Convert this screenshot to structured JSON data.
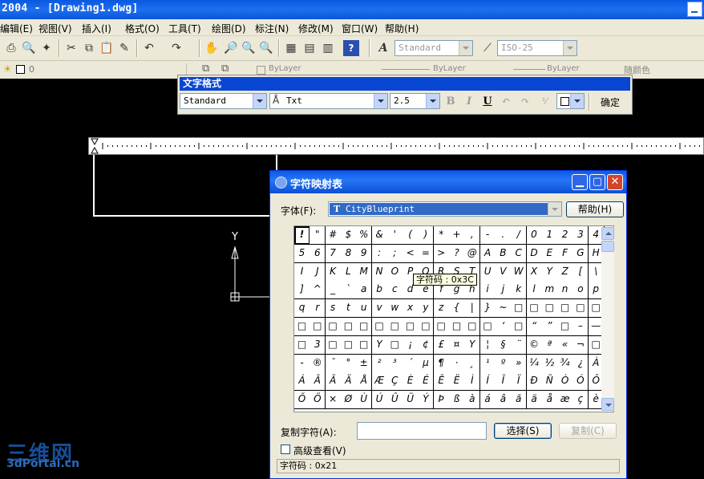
{
  "window": {
    "title": "2004 - [Drawing1.dwg]"
  },
  "menu": [
    "编辑(E)",
    "视图(V)",
    "插入(I)",
    "格式(O)",
    "工具(T)",
    "绘图(D)",
    "标注(N)",
    "修改(M)",
    "窗口(W)",
    "帮助(H)"
  ],
  "toolbar": {
    "text_style": "Standard",
    "dim_style": "ISO-25"
  },
  "layers": {
    "current": "0",
    "color": "ByLayer",
    "linetype": "ByLayer",
    "lineweight": "ByLayer",
    "plotstyle": "随颜色"
  },
  "text_formatting": {
    "title": "文字格式",
    "style": "Standard",
    "font": "Txt",
    "height": "2.5",
    "bold": "B",
    "italic": "I",
    "underline": "U",
    "ok": "确定"
  },
  "axes": {
    "y_label": "Y"
  },
  "charmap": {
    "title": "字符映射表",
    "font_label": "字体(F):",
    "font_value": "CityBlueprint",
    "help_button": "帮助(H)",
    "tooltip": "字符码 : 0x3C",
    "copy_label": "复制字符(A):",
    "copy_value": "",
    "select_button": "选择(S)",
    "copy_button": "复制(C)",
    "advanced_label": "高级查看(V)",
    "status": "字符码 : 0x21",
    "rows": [
      [
        "!",
        "\"",
        "#",
        "$",
        "%",
        "&",
        "'",
        "(",
        ")",
        "*",
        "+",
        ",",
        "-",
        ".",
        "/",
        "0",
        "1",
        "2",
        "3",
        "4"
      ],
      [
        "5",
        "6",
        "7",
        "8",
        "9",
        ":",
        ";",
        "<",
        "=",
        ">",
        "?",
        "@",
        "A",
        "B",
        "C",
        "D",
        "E",
        "F",
        "G",
        "H"
      ],
      [
        "I",
        "J",
        "K",
        "L",
        "M",
        "N",
        "O",
        "P",
        "Q",
        "R",
        "S",
        "T",
        "U",
        "V",
        "W",
        "X",
        "Y",
        "Z",
        "[",
        "\\"
      ],
      [
        "]",
        "^",
        "_",
        "`",
        "a",
        "b",
        "c",
        "d",
        "e",
        "f",
        "g",
        "h",
        "i",
        "j",
        "k",
        "l",
        "m",
        "n",
        "o",
        "p"
      ],
      [
        "q",
        "r",
        "s",
        "t",
        "u",
        "v",
        "w",
        "x",
        "y",
        "z",
        "{",
        "|",
        "}",
        "~",
        "□",
        "□",
        "□",
        "□",
        "□",
        "□"
      ],
      [
        "□",
        "□",
        "□",
        "□",
        "□",
        "□",
        "□",
        "□",
        "□",
        "□",
        "□",
        "□",
        "□",
        "‘",
        "□",
        "“",
        "”",
        "□",
        "–",
        "—"
      ],
      [
        "□",
        "3",
        "□",
        "□",
        "□",
        "Y",
        "□",
        "¡",
        "¢",
        "£",
        "¤",
        "Y",
        "¦",
        "§",
        "¨",
        "©",
        "ª",
        "«",
        "¬",
        "□"
      ],
      [
        "-",
        "®",
        "¯",
        "°",
        "±",
        "²",
        "³",
        "´",
        "µ",
        "¶",
        "·",
        "¸",
        "¹",
        "º",
        "»",
        "¼",
        "½",
        "¾",
        "¿",
        "À"
      ],
      [
        "Á",
        "Â",
        "Ã",
        "Ä",
        "Å",
        "Æ",
        "Ç",
        "È",
        "É",
        "Ê",
        "Ë",
        "Ì",
        "Í",
        "Î",
        "Ï",
        "Ð",
        "Ñ",
        "Ò",
        "Ó",
        "Ô"
      ],
      [
        "Õ",
        "Ö",
        "×",
        "Ø",
        "Ù",
        "Ú",
        "Û",
        "Ü",
        "Ý",
        "Þ",
        "ß",
        "à",
        "á",
        "â",
        "ã",
        "ä",
        "å",
        "æ",
        "ç",
        "è"
      ]
    ]
  },
  "watermark": {
    "line1": "三维网",
    "line2": "3dPortal.cn"
  }
}
